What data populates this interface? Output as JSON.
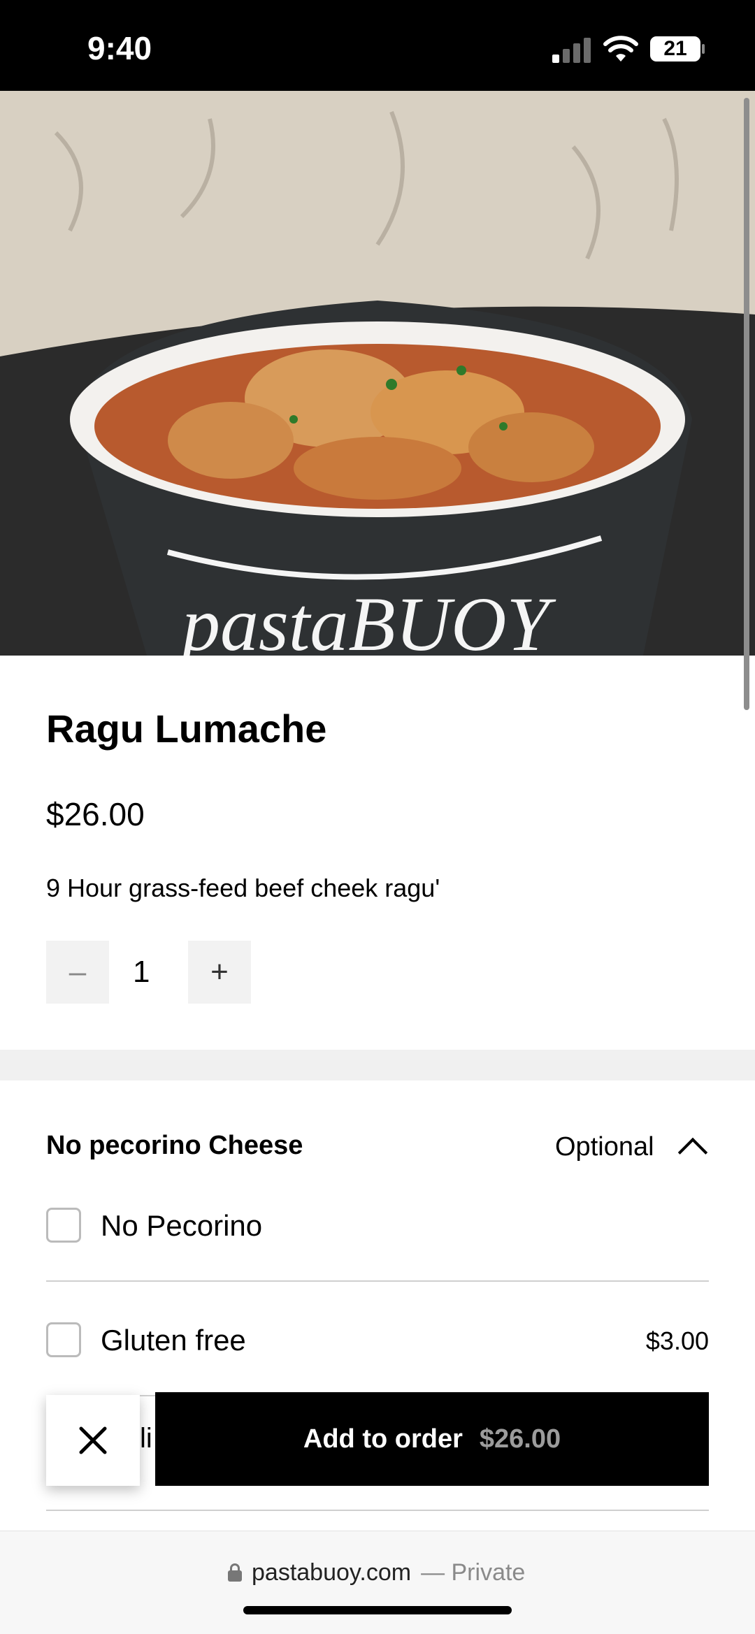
{
  "status_bar": {
    "time": "9:40",
    "battery": "21"
  },
  "hero": {
    "brand_text": "pastaBUOY"
  },
  "item": {
    "title": "Ragu Lumache",
    "price": "$26.00",
    "description": "9 Hour grass-feed beef cheek ragu'"
  },
  "quantity": {
    "value": "1",
    "minus_label": "–",
    "plus_label": "+"
  },
  "modifier_group": {
    "title": "No pecorino Cheese",
    "badge": "Optional",
    "options": [
      {
        "label": "No Pecorino",
        "price": ""
      },
      {
        "label": "Gluten free",
        "price": "$3.00"
      },
      {
        "label": "li",
        "price": ""
      }
    ]
  },
  "footer_actions": {
    "add_label": "Add to order",
    "add_price": "$26.00"
  },
  "browser": {
    "domain": "pastabuoy.com",
    "private_label": "— Private"
  },
  "colors": {
    "accent": "#000000",
    "background_band": "#f0f0f0",
    "muted_text": "#9c9c9c"
  }
}
